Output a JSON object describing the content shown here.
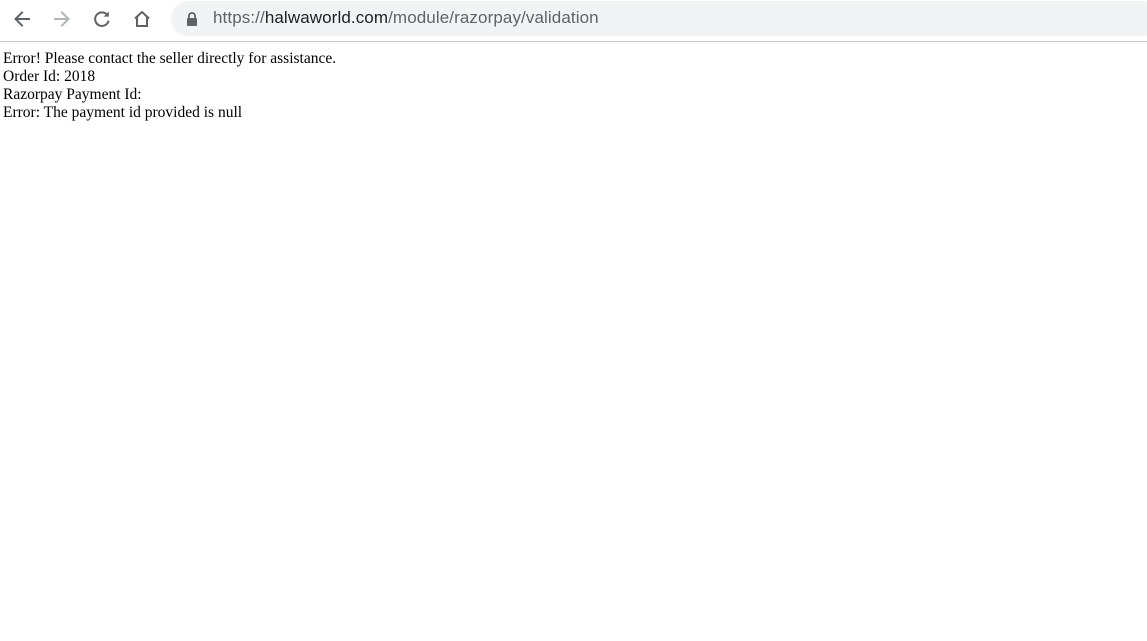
{
  "browser": {
    "back_icon": "arrow-left-icon",
    "forward_icon": "arrow-right-icon",
    "reload_icon": "reload-icon",
    "home_icon": "home-icon",
    "lock_icon": "lock-icon",
    "url": {
      "scheme": "https://",
      "host": "halwaworld.com",
      "path": "/module/razorpay/validation"
    },
    "colors": {
      "icon_active": "#5f6368",
      "icon_disabled": "#b2b5b9",
      "omnibox_bg": "#f1f3f4"
    }
  },
  "page": {
    "lines": [
      "Error! Please contact the seller directly for assistance.",
      "Order Id: 2018",
      "Razorpay Payment Id:",
      "Error: The payment id provided is null"
    ]
  }
}
